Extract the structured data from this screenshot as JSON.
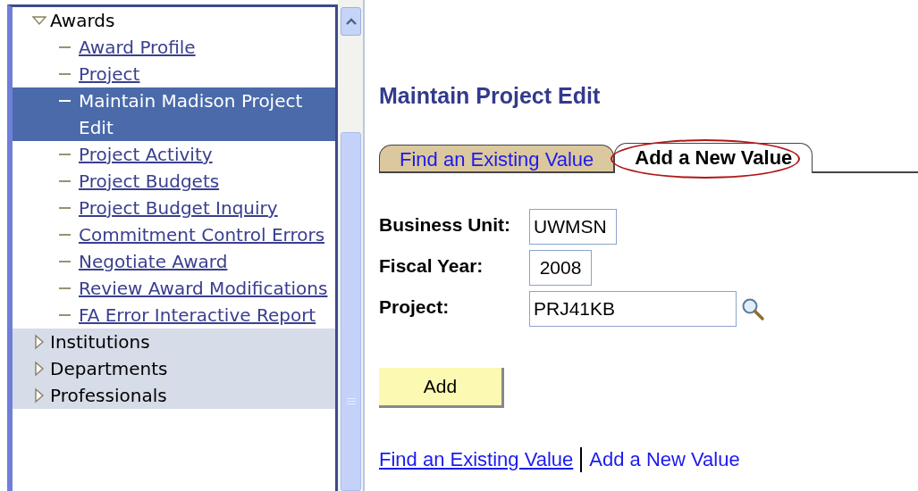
{
  "sidebar": {
    "items": [
      {
        "label": "Awards",
        "expanded": true,
        "selected": false,
        "children": [
          {
            "label": "Award Profile",
            "selected": false
          },
          {
            "label": "Project",
            "selected": false
          },
          {
            "label": "Maintain Madison Project Edit",
            "selected": true
          },
          {
            "label": "Project Activity",
            "selected": false
          },
          {
            "label": "Project Budgets",
            "selected": false
          },
          {
            "label": "Project Budget Inquiry",
            "selected": false
          },
          {
            "label": "Commitment Control Errors",
            "selected": false
          },
          {
            "label": "Negotiate Award",
            "selected": false
          },
          {
            "label": "Review Award Modifications",
            "selected": false
          },
          {
            "label": "FA Error Interactive Report",
            "selected": false
          }
        ]
      },
      {
        "label": "Institutions",
        "expanded": false,
        "selected": false
      },
      {
        "label": "Departments",
        "expanded": false,
        "selected": false
      },
      {
        "label": "Professionals",
        "expanded": false,
        "selected": false
      }
    ]
  },
  "page": {
    "title": "Maintain Project Edit",
    "tabs": [
      {
        "label": "Find an Existing Value",
        "selected": false,
        "highlighted": false
      },
      {
        "label": "Add a New Value",
        "selected": true,
        "highlighted": true
      }
    ],
    "fields": [
      {
        "label": "Business Unit:",
        "value": "UWMSN",
        "lookup": false
      },
      {
        "label": "Fiscal Year:",
        "value": "2008",
        "lookup": false
      },
      {
        "label": "Project:",
        "value": "PRJ41KB",
        "lookup": true
      }
    ],
    "button": "Add",
    "links": [
      {
        "label": "Find an Existing Value",
        "selected": false
      },
      {
        "label": "Add a New Value",
        "selected": true
      }
    ]
  }
}
